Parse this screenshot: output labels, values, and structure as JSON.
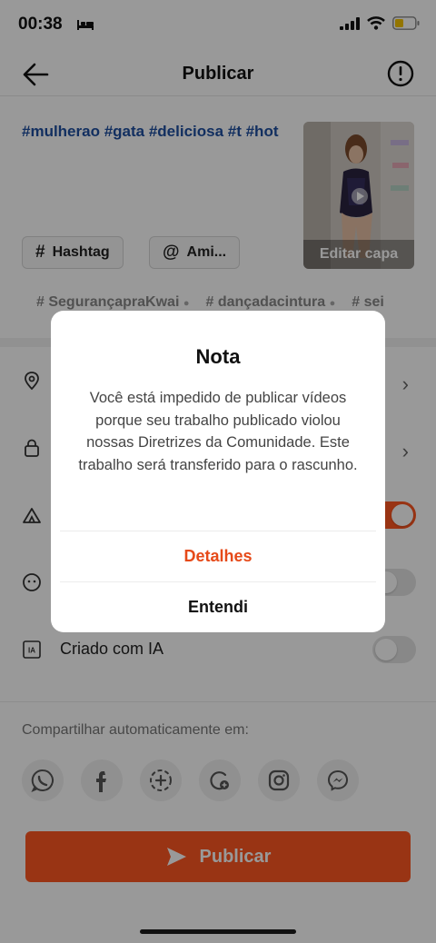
{
  "status_bar": {
    "time": "00:38"
  },
  "header": {
    "title": "Publicar"
  },
  "caption": {
    "text": "#mulherao #gata #deliciosa #t #hot"
  },
  "thumbnail": {
    "edit_cover_label": "Editar capa"
  },
  "chips": {
    "hashtag": "Hashtag",
    "friends": "Ami..."
  },
  "suggested_tags": [
    "# SegurançapraKwai",
    "# dançadacintura",
    "# sei"
  ],
  "settings": {
    "ai_created_label": "Criado com IA"
  },
  "share": {
    "label": "Compartilhar automaticamente em:"
  },
  "publish_button": {
    "label": "Publicar"
  },
  "dialog": {
    "title": "Nota",
    "message": "Você está impedido de publicar vídeos porque seu trabalho publicado violou nossas Diretrizes da Comunidade. Este trabalho será transferido para o rascunho.",
    "details_button": "Detalhes",
    "ok_button": "Entendi"
  },
  "colors": {
    "accent": "#ff5722",
    "hashtag_blue": "#1f4fa0"
  }
}
